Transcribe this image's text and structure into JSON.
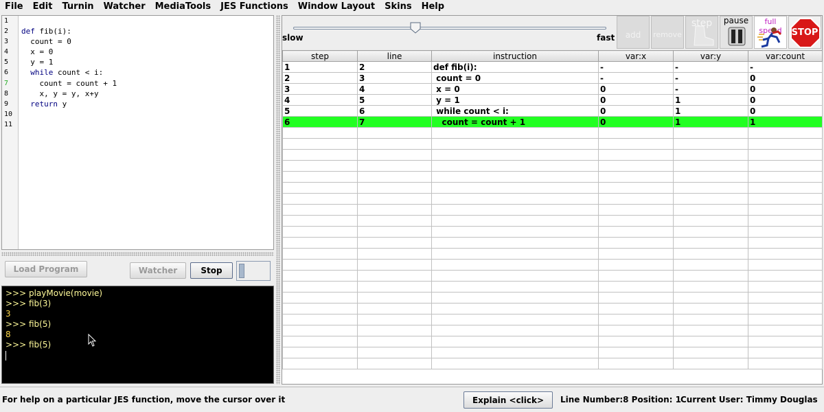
{
  "menu": [
    "File",
    "Edit",
    "Turnin",
    "Watcher",
    "MediaTools",
    "JES Functions",
    "Window Layout",
    "Skins",
    "Help"
  ],
  "editor": {
    "line_numbers": [
      "1",
      "2",
      "3",
      "4",
      "5",
      "6",
      "7",
      "8",
      "9",
      "10",
      "11"
    ],
    "active_line": 7,
    "lines": [
      "",
      "def fib(i):",
      "  count = 0",
      "  x = 0",
      "  y = 1",
      "  while count < i:",
      "    count = count + 1",
      "    x, y = y, x+y",
      "  return y",
      "",
      ""
    ]
  },
  "buttons": {
    "load_program": "Load Program",
    "watcher": "Watcher",
    "stop": "Stop"
  },
  "console": {
    "lines": [
      {
        "text": ">>> playMovie(movie)",
        "kind": "prompt"
      },
      {
        "text": ">>> fib(3)",
        "kind": "prompt"
      },
      {
        "text": "3",
        "kind": "result"
      },
      {
        "text": ">>> fib(5)",
        "kind": "prompt"
      },
      {
        "text": "8",
        "kind": "result"
      },
      {
        "text": ">>> fib(5)",
        "kind": "prompt"
      }
    ]
  },
  "speed": {
    "slow_label": "slow",
    "fast_label": "fast",
    "value_fraction": 0.39
  },
  "tools": {
    "add": "add",
    "remove": "remove",
    "step": "step",
    "pause": "pause",
    "full_speed": "full speed",
    "stop": "STOP"
  },
  "table": {
    "headers": [
      "step",
      "line",
      "instruction",
      "var:x",
      "var:y",
      "var:count"
    ],
    "rows": [
      [
        "1",
        "2",
        "def fib(i):",
        "-",
        "-",
        "-"
      ],
      [
        "2",
        "3",
        " count = 0",
        "-",
        "-",
        "0"
      ],
      [
        "3",
        "4",
        " x = 0",
        "0",
        "-",
        "0"
      ],
      [
        "4",
        "5",
        " y = 1",
        "0",
        "1",
        "0"
      ],
      [
        "5",
        "6",
        " while count < i:",
        "0",
        "1",
        "0"
      ],
      [
        "6",
        "7",
        "   count = count + 1",
        "0",
        "1",
        "1"
      ]
    ],
    "highlight_row": 5,
    "highlight_color": "#22ff22"
  },
  "status": {
    "help": "For help on a particular JES function, move the cursor over it",
    "explain": "Explain <click>",
    "line_position": "Line Number:8  Position: 1",
    "user": "Current User: Timmy Douglas"
  }
}
